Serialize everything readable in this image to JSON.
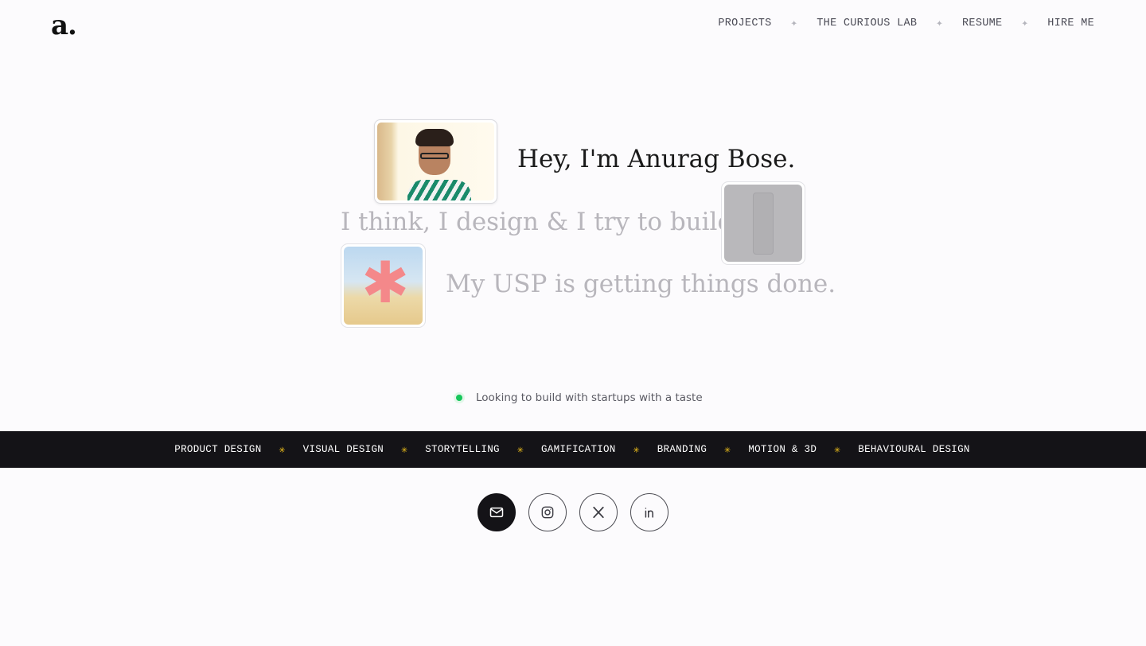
{
  "header": {
    "logo": "a.",
    "nav": [
      {
        "label": "PROJECTS"
      },
      {
        "label": "THE CURIOUS LAB"
      },
      {
        "label": "RESUME"
      },
      {
        "label": "HIRE ME"
      }
    ],
    "separator": "✦"
  },
  "hero": {
    "line1": "Hey, I'm Anurag Bose.",
    "line2": "I think, I design & I try to build",
    "line3": "My USP is getting things done."
  },
  "status": {
    "text": "Looking to build with startups with a taste",
    "dot_color": "#16c65b"
  },
  "band": {
    "items": [
      "PRODUCT DESIGN",
      "VISUAL DESIGN",
      "STORYTELLING",
      "GAMIFICATION",
      "BRANDING",
      "MOTION & 3D",
      "BEHAVIOURAL DESIGN"
    ],
    "separator": "✳",
    "separator_color": "#f2c21b"
  },
  "socials": [
    {
      "icon": "mail-icon"
    },
    {
      "icon": "instagram-icon"
    },
    {
      "icon": "x-icon"
    },
    {
      "icon": "linkedin-icon"
    }
  ],
  "colors": {
    "background": "#fcfbfd",
    "band_background": "#141317",
    "muted_text": "#b8b6bc"
  }
}
